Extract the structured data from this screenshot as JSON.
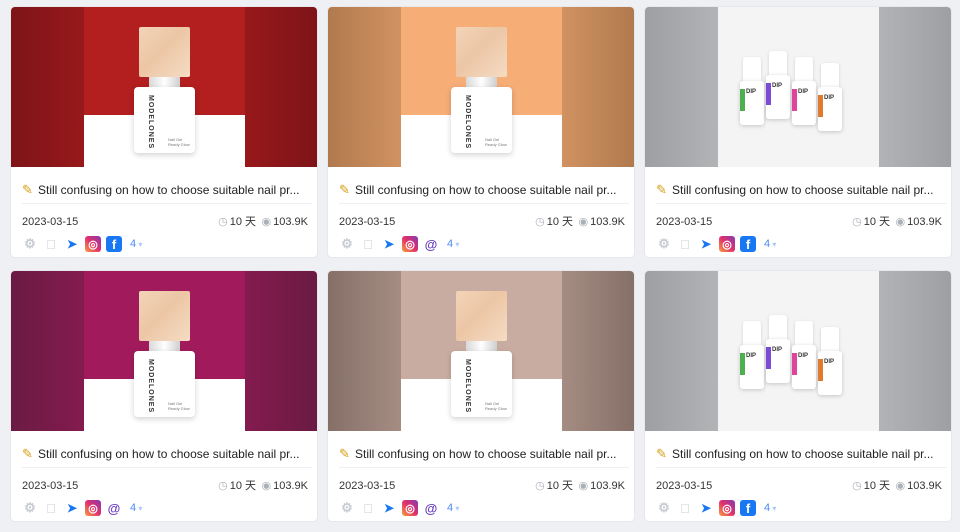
{
  "cards": [
    {
      "title": "Still confusing on how to choose suitable nail pr...",
      "date": "2023-03-15",
      "duration": "10 天",
      "views": "103.9K",
      "more_count": "4",
      "product": "bottle",
      "bg_color": "#7e1418",
      "accent_color": "#b31e1e",
      "platforms": [
        "android-icon",
        "apple-icon",
        "messenger-icon",
        "instagram-icon",
        "facebook-icon"
      ]
    },
    {
      "title": "Still confusing on how to choose suitable nail pr...",
      "date": "2023-03-15",
      "duration": "10 天",
      "views": "103.9K",
      "more_count": "4",
      "product": "bottle",
      "bg_color": "#b07a4e",
      "accent_color": "#f6ad76",
      "platforms": [
        "android-icon",
        "apple-icon",
        "messenger-icon",
        "instagram-icon",
        "threads-icon"
      ]
    },
    {
      "title": "Still confusing on how to choose suitable nail pr...",
      "date": "2023-03-15",
      "duration": "10 天",
      "views": "103.9K",
      "more_count": "4",
      "product": "dip",
      "bg_color": "#9d9fa2",
      "accent_color": "#f4f4f5",
      "platforms": [
        "android-icon",
        "apple-icon",
        "messenger-icon",
        "instagram-icon",
        "facebook-icon"
      ]
    },
    {
      "title": "Still confusing on how to choose suitable nail pr...",
      "date": "2023-03-15",
      "duration": "10 天",
      "views": "103.9K",
      "more_count": "4",
      "product": "bottle",
      "bg_color": "#6a1b43",
      "accent_color": "#a11b5c",
      "platforms": [
        "android-icon",
        "apple-icon",
        "messenger-icon",
        "instagram-icon",
        "threads-icon"
      ]
    },
    {
      "title": "Still confusing on how to choose suitable nail pr...",
      "date": "2023-03-15",
      "duration": "10 天",
      "views": "103.9K",
      "more_count": "4",
      "product": "bottle",
      "bg_color": "#857068",
      "accent_color": "#c9aca1",
      "platforms": [
        "android-icon",
        "apple-icon",
        "messenger-icon",
        "instagram-icon",
        "threads-icon"
      ]
    },
    {
      "title": "Still confusing on how to choose suitable nail pr...",
      "date": "2023-03-15",
      "duration": "10 天",
      "views": "103.9K",
      "more_count": "4",
      "product": "dip",
      "bg_color": "#9d9fa2",
      "accent_color": "#f4f4f5",
      "platforms": [
        "android-icon",
        "apple-icon",
        "messenger-icon",
        "instagram-icon",
        "facebook-icon"
      ]
    }
  ],
  "bottle_label": {
    "brand": "MODELONES",
    "line1": "Nail Gel",
    "line2": "Ready Glow"
  },
  "dip_label": "DIP",
  "icons": {
    "title_icon": "pen-icon",
    "clock_icon": "clock-icon",
    "eye_icon": "eye-icon",
    "more_icon": "chevron-down-icon"
  },
  "dip_colors": [
    "#4caf50",
    "#7b4bd6",
    "#e0449a",
    "#e07a2e"
  ]
}
